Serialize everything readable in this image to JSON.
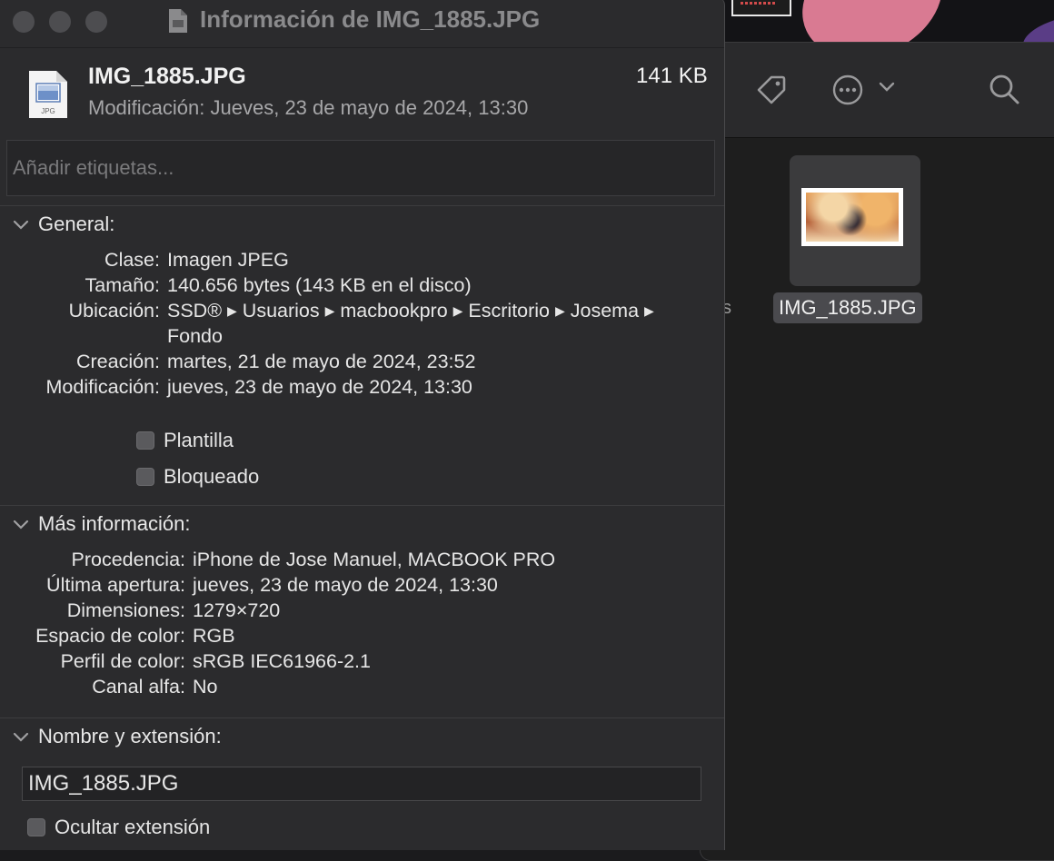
{
  "window": {
    "title": "Información de IMG_1885.JPG"
  },
  "header": {
    "file_name": "IMG_1885.JPG",
    "file_size": "141 KB",
    "modified_label": "Modificación:",
    "modified_value": "Jueves, 23 de mayo de 2024, 13:30",
    "icon_text": "JPG"
  },
  "tags": {
    "placeholder": "Añadir etiquetas..."
  },
  "general": {
    "heading": "General:",
    "rows": [
      {
        "label": "Clase:",
        "value": "Imagen JPEG"
      },
      {
        "label": "Tamaño:",
        "value": "140.656 bytes (143 KB en el disco)"
      },
      {
        "label": "Ubicación:",
        "value": "SSD® ▸ Usuarios ▸ macbookpro ▸ Escritorio ▸ Josema ▸"
      },
      {
        "label": "",
        "value": "Fondo"
      },
      {
        "label": "Creación:",
        "value": "martes, 21 de mayo de 2024, 23:52"
      },
      {
        "label": "Modificación:",
        "value": "jueves, 23 de mayo de 2024, 13:30"
      }
    ],
    "checkboxes": [
      {
        "label": "Plantilla",
        "checked": false
      },
      {
        "label": "Bloqueado",
        "checked": false
      }
    ]
  },
  "more_info": {
    "heading": "Más información:",
    "rows": [
      {
        "label": "Procedencia:",
        "value": "iPhone de Jose Manuel, MACBOOK PRO"
      },
      {
        "label": "Última apertura:",
        "value": "jueves, 23 de mayo de 2024, 13:30"
      },
      {
        "label": "Dimensiones:",
        "value": "1279×720"
      },
      {
        "label": "Espacio de color:",
        "value": "RGB"
      },
      {
        "label": "Perfil de color:",
        "value": "sRGB IEC61966-2.1"
      },
      {
        "label": "Canal alfa:",
        "value": "No"
      }
    ]
  },
  "name_ext": {
    "heading": "Nombre y extensión:",
    "value": "IMG_1885.JPG",
    "hide_extension_label": "Ocultar extensión",
    "hide_extension_checked": false
  },
  "finder": {
    "file_label": "IMG_1885.JPG",
    "stray_text": "s",
    "icons": [
      "tag-icon",
      "more-icon",
      "chevron-down-icon",
      "search-icon"
    ]
  },
  "colors": {
    "window_bg": "#2b2b2d",
    "text": "#e6e6e6",
    "muted": "#a7a7a9",
    "wallpaper_pink": "#d97a92",
    "wallpaper_purple": "#5a3d86"
  }
}
